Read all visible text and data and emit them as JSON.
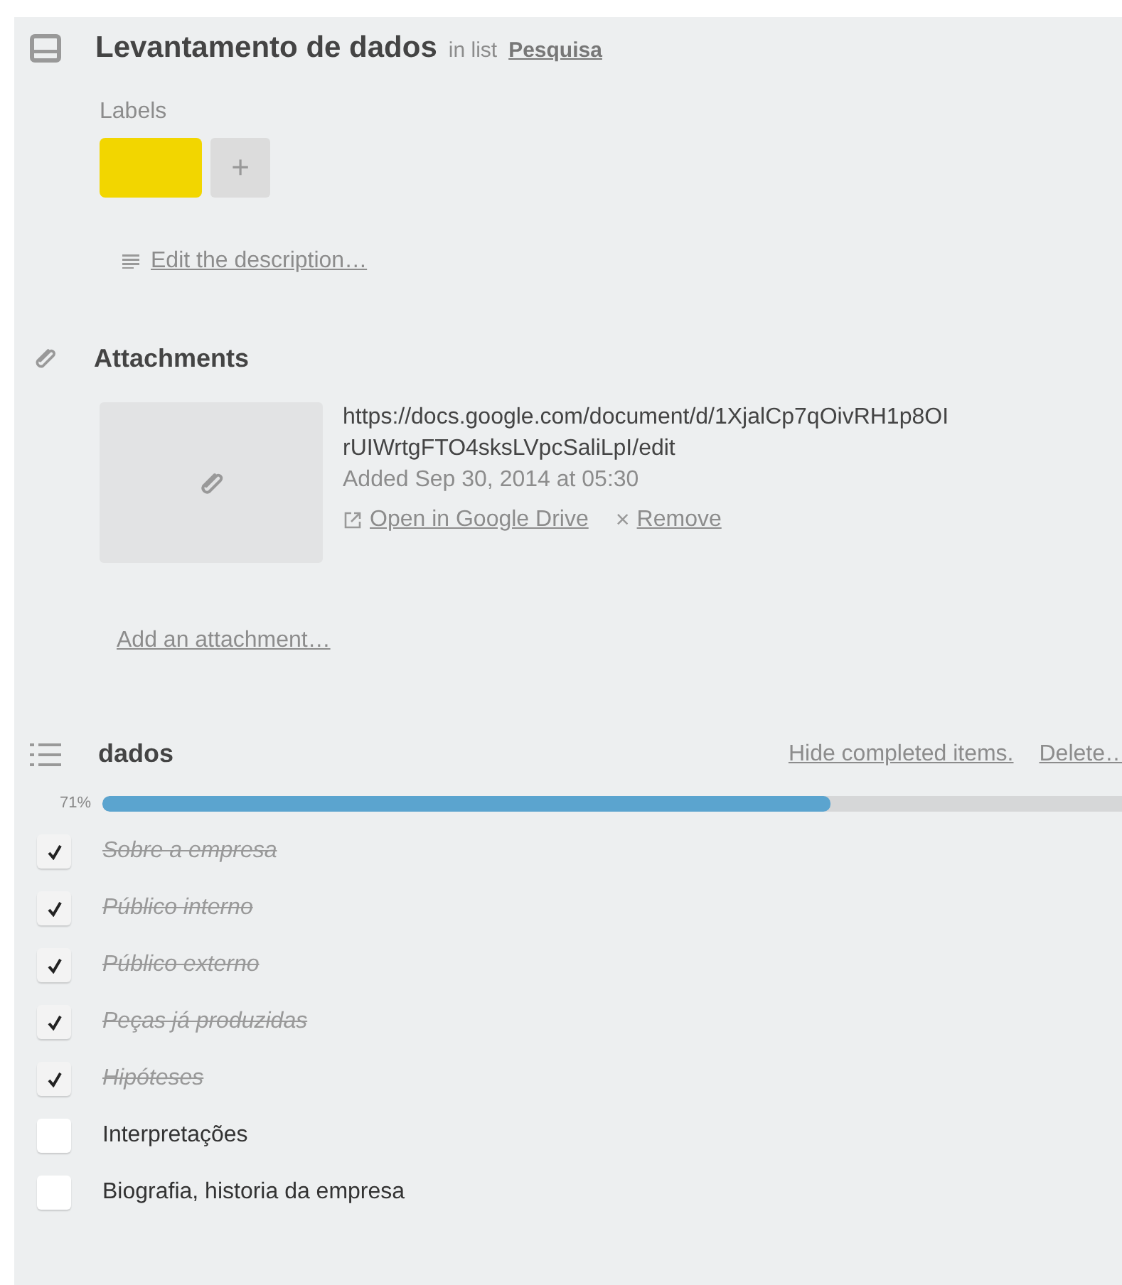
{
  "card": {
    "title": "Levantamento de dados",
    "list_prefix": "in list",
    "list_name": "Pesquisa"
  },
  "labels": {
    "heading": "Labels",
    "items": [
      {
        "color": "#f2d600"
      }
    ],
    "add": "+"
  },
  "description": {
    "link": "Edit the description…"
  },
  "attachments": {
    "heading": "Attachments",
    "items": [
      {
        "url": "https://docs.google.com/document/d/1XjalCp7qOivRH1p8OI rUIWrtgFTO4sksLVpcSaliLpI/edit",
        "added": "Added Sep 30, 2014 at 05:30",
        "open": "Open in Google Drive",
        "remove_mark": "×",
        "remove": "Remove"
      }
    ],
    "add": "Add an attachment…"
  },
  "checklist": {
    "title": "dados",
    "hide": "Hide completed items.",
    "delete": "Delete…",
    "percent": "71%",
    "level": 0.714,
    "items": [
      {
        "text": "Sobre a empresa",
        "checked": true
      },
      {
        "text": "Público interno",
        "checked": true
      },
      {
        "text": "Público externo",
        "checked": true
      },
      {
        "text": "Peças já produzidas",
        "checked": true
      },
      {
        "text": "Hipóteses",
        "checked": true
      },
      {
        "text": "Interpretações",
        "checked": false
      },
      {
        "text": "Biografia, historia da empresa",
        "checked": false
      }
    ]
  }
}
